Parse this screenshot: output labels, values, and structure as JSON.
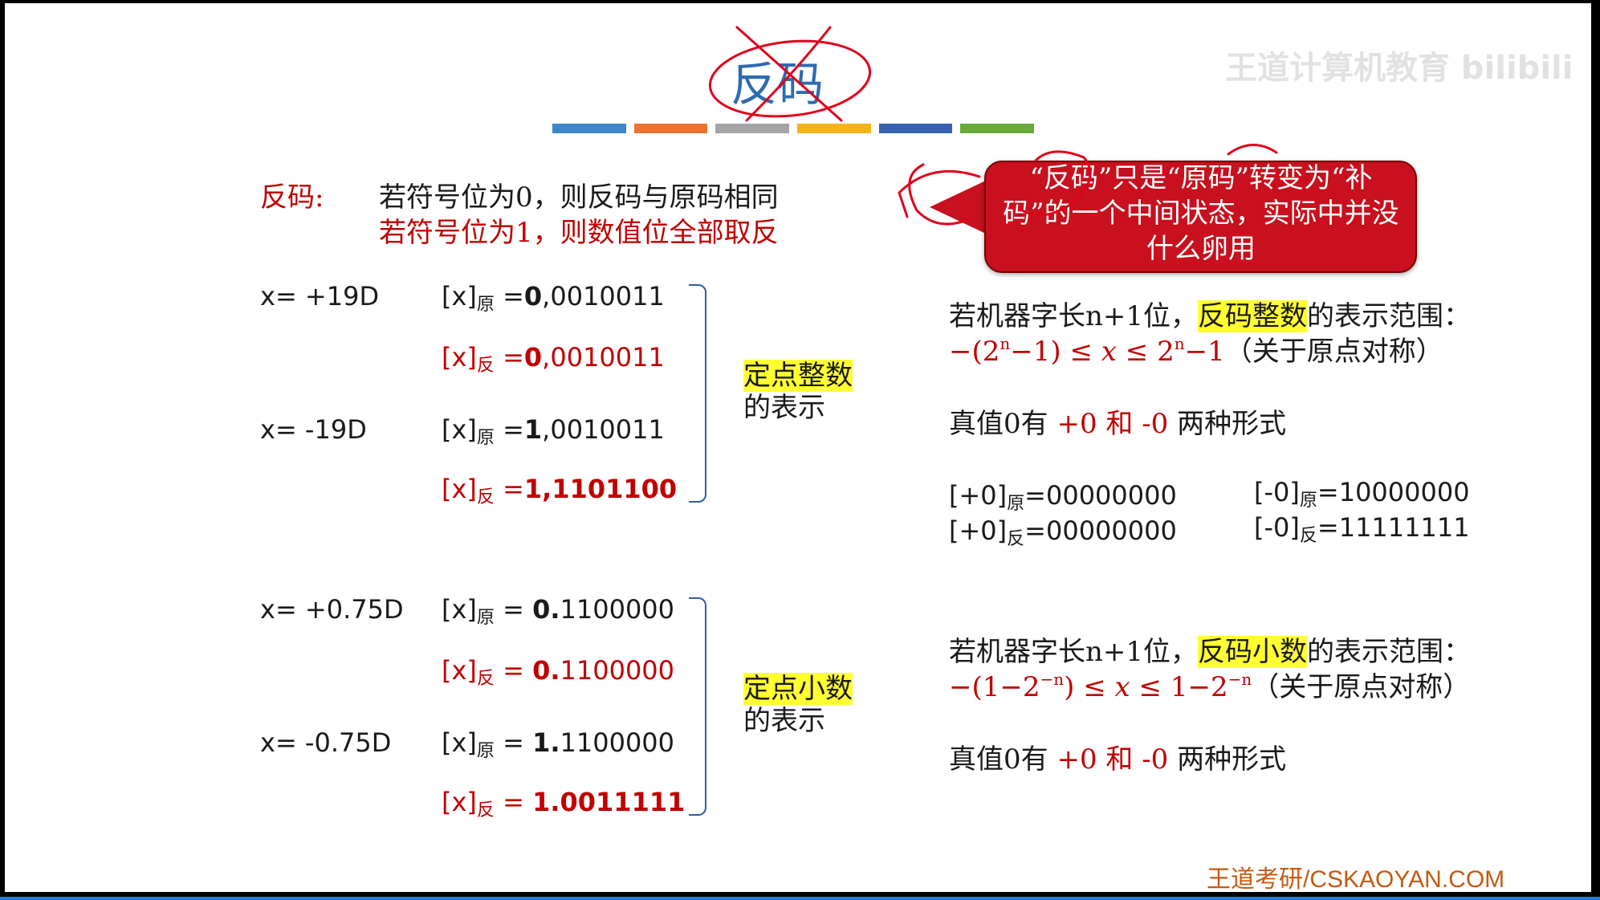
{
  "title": "反码",
  "watermark": "王道计算机教育 bilibili",
  "stripe_colors": [
    "#3d87c9",
    "#e8742e",
    "#a5a5a5",
    "#f3b41b",
    "#3763b0",
    "#6aaa3a"
  ],
  "definition": {
    "label": "反码:",
    "line1": "若符号位为0，则反码与原码相同",
    "line2": "若符号位为1，则数值位全部取反"
  },
  "bubble": {
    "text": "“反码”只是“原码”转变为“补码”的一个中间状态，实际中并没什么卵用"
  },
  "integer": {
    "x_pos": "x= +19D",
    "x_neg": "x= -19D",
    "rows": [
      {
        "prefix": "[x]",
        "sub": "原",
        "eq": " =",
        "bold": "0",
        ",rest": "",
        "rest": ",0010011"
      },
      {
        "prefix": "[x]",
        "sub": "反",
        "eq": " =",
        "bold": "0",
        "rest": ",0010011"
      },
      {
        "prefix": "[x]",
        "sub": "原",
        "eq": " =",
        "bold": "1",
        "rest": ",0010011"
      },
      {
        "prefix": "[x]",
        "sub": "反",
        "eq": " =",
        "bold": "1,1101100",
        "rest": ""
      }
    ],
    "brace_label_hl": "定点整数",
    "brace_label": "的表示"
  },
  "fraction": {
    "x_pos": "x= +0.75D",
    "x_neg": "x= -0.75D",
    "rows": [
      {
        "prefix": "[x]",
        "sub": "原",
        "eq": " = ",
        "bold": "0.",
        "rest": "1100000"
      },
      {
        "prefix": "[x]",
        "sub": "反",
        "eq": " = ",
        "bold": "0.",
        "rest": "1100000"
      },
      {
        "prefix": "[x]",
        "sub": "原",
        "eq": " = ",
        "bold": "1.",
        "rest": "1100000"
      },
      {
        "prefix": "[x]",
        "sub": "反",
        "eq": " = ",
        "bold": "1.0011111",
        "rest": ""
      }
    ],
    "brace_label_hl": "定点小数",
    "brace_label": "的表示"
  },
  "range_int": {
    "pre": "若机器字长n+1位，",
    "hl": "反码整数",
    "post": "的表示范围：",
    "formula_a": "−(2",
    "sup1": "n",
    "formula_b": "−1) ≤",
    "x": "x",
    "formula_c": "≤ 2",
    "sup2": "n",
    "formula_d": "−1",
    "note": "（关于原点对称）"
  },
  "zero_int": {
    "pre": "真值0有 ",
    "red": "+0 和 -0",
    "post": " 两种形式"
  },
  "zero_codes": {
    "p_orig_pre": "[+0]",
    "p_orig_sub": "原",
    "p_orig_val": "=00000000",
    "p_inv_pre": "[+0]",
    "p_inv_sub": "反",
    "p_inv_val": "=00000000",
    "n_orig_pre": "[-0]",
    "n_orig_sub": "原",
    "n_orig_val": "=10000000",
    "n_inv_pre": "[-0]",
    "n_inv_sub": "反",
    "n_inv_val": "=11111111"
  },
  "range_frac": {
    "pre": "若机器字长n+1位，",
    "hl": "反码小数",
    "post": "的表示范围：",
    "formula_a": "−(1−2",
    "sup1": "−n",
    "formula_b": ") ≤",
    "x": "x",
    "formula_c": "≤ 1−2",
    "sup2": "−n",
    "note": "（关于原点对称）"
  },
  "zero_frac": {
    "pre": "真值0有 ",
    "red": "+0 和 -0",
    "post": " 两种形式"
  },
  "footer": "王道考研/CSKAOYAN.COM"
}
